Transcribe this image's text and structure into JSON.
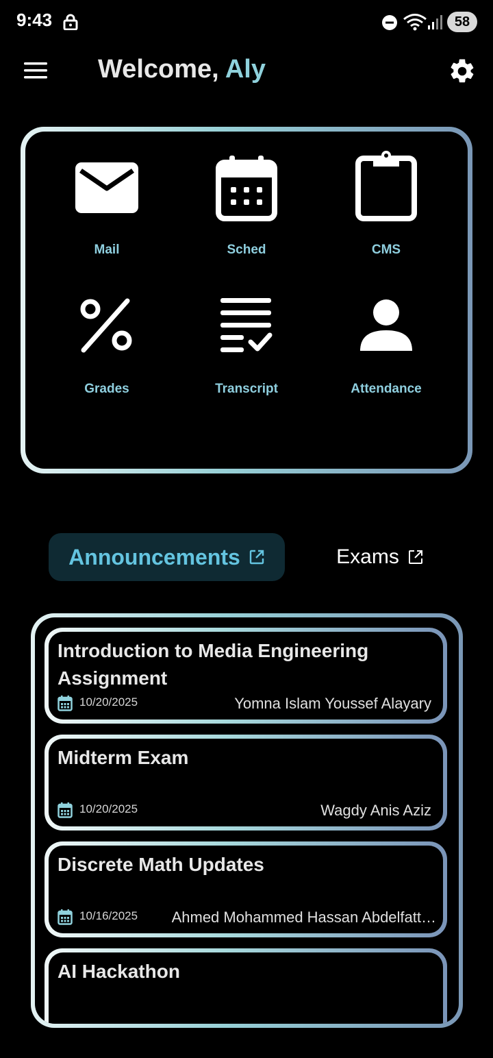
{
  "status_bar": {
    "time": "9:43",
    "battery": "58",
    "icons": [
      "lock-icon",
      "dnd-icon",
      "wifi-icon",
      "signal-icon"
    ]
  },
  "header": {
    "welcome_prefix": "Welcome,",
    "user_name": "Aly",
    "menu_icon": "hamburger-menu-icon",
    "settings_icon": "gear-icon"
  },
  "tiles": [
    {
      "label": "Mail",
      "icon": "mail-icon"
    },
    {
      "label": "Sched",
      "icon": "calendar-icon"
    },
    {
      "label": "CMS",
      "icon": "clipboard-icon"
    },
    {
      "label": "Grades",
      "icon": "percent-icon"
    },
    {
      "label": "Transcript",
      "icon": "transcript-icon"
    },
    {
      "label": "Attendance",
      "icon": "person-icon"
    }
  ],
  "tabs": {
    "announcements": {
      "label": "Announcements",
      "active": true,
      "icon": "external-link-icon"
    },
    "exams": {
      "label": "Exams",
      "active": false,
      "icon": "external-link-icon"
    }
  },
  "announcements": [
    {
      "title": "Introduction to Media Engineering Assignment",
      "date": "10/20/2025",
      "author": "Yomna Islam Youssef Alayary"
    },
    {
      "title": "Midterm Exam",
      "date": "10/20/2025",
      "author": "Wagdy Anis Aziz"
    },
    {
      "title": "Discrete Math Updates",
      "date": "10/16/2025",
      "author": "Ahmed Mohammed Hassan Abdelfatt…"
    },
    {
      "title": "AI Hackathon",
      "date": "",
      "author": ""
    }
  ],
  "colors": {
    "accent": "#8fd1dc",
    "tab_active_text": "#64c4e0",
    "tab_active_bg": "#0f2a33",
    "background": "#000000"
  }
}
